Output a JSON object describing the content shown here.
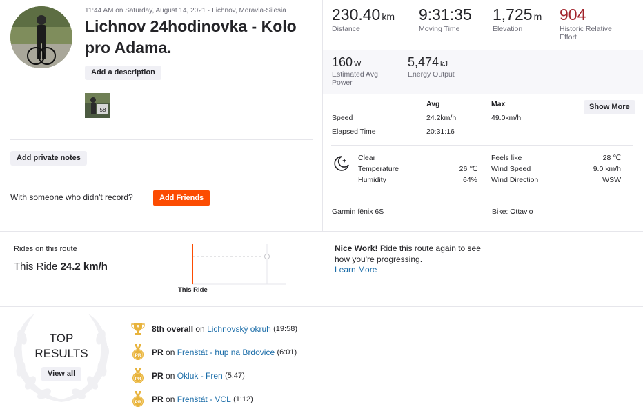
{
  "activity": {
    "timestamp": "11:44 AM on Saturday, August 14, 2021 · Lichnov, Moravia-Silesia",
    "title": "Lichnov 24hodinovka - Kolo pro Adama.",
    "add_description": "Add a description",
    "photo_badge": "58",
    "add_private_notes": "Add private notes",
    "friends_question": "With someone who didn't record?",
    "add_friends": "Add Friends"
  },
  "stats": {
    "distance": {
      "value": "230.40",
      "unit": "km",
      "label": "Distance"
    },
    "moving_time": {
      "value": "9:31:35",
      "unit": "",
      "label": "Moving Time"
    },
    "elevation": {
      "value": "1,725",
      "unit": "m",
      "label": "Elevation"
    },
    "relative_effort": {
      "value": "904",
      "unit": "",
      "label": "Historic Relative Effort"
    },
    "power": {
      "value": "160",
      "unit": "W",
      "label": "Estimated Avg Power"
    },
    "energy": {
      "value": "5,474",
      "unit": "kJ",
      "label": "Energy Output"
    }
  },
  "table": {
    "avg_header": "Avg",
    "max_header": "Max",
    "show_more": "Show More",
    "speed_label": "Speed",
    "speed_avg": "24.2km/h",
    "speed_max": "49.0km/h",
    "elapsed_label": "Elapsed Time",
    "elapsed_avg": "20:31:16"
  },
  "weather": {
    "condition": "Clear",
    "temperature_label": "Temperature",
    "temperature": "26 ℃",
    "humidity_label": "Humidity",
    "humidity": "64%",
    "feels_like_label": "Feels like",
    "feels_like": "28 ℃",
    "wind_speed_label": "Wind Speed",
    "wind_speed": "9.0 km/h",
    "wind_dir_label": "Wind Direction",
    "wind_dir": "WSW"
  },
  "device": {
    "name": "Garmin fēnix 6S",
    "bike": "Bike: Ottavio"
  },
  "route": {
    "label": "Rides on this route",
    "this_ride_prefix": "This Ride",
    "this_ride_speed": "24.2 km/h",
    "chart_caption": "This Ride",
    "nice_bold": "Nice Work!",
    "nice_text": "Ride this route again to see how you're progressing.",
    "learn_more": "Learn More"
  },
  "top_results": {
    "title_line1": "TOP",
    "title_line2": "RESULTS",
    "view_all": "View all",
    "items": [
      {
        "icon": "trophy-icon",
        "rank": "8th overall",
        "on": "on",
        "segment": "Lichnovský okruh",
        "time": "(19:58)",
        "badge": "8"
      },
      {
        "icon": "pr-medal-icon",
        "rank": "PR",
        "on": "on",
        "segment": "Frenštát - hup na Brdovice",
        "time": "(6:01)",
        "badge": "PR"
      },
      {
        "icon": "pr-medal-icon",
        "rank": "PR",
        "on": "on",
        "segment": "Okluk - Fren",
        "time": "(5:47)",
        "badge": "PR"
      },
      {
        "icon": "pr-medal-icon",
        "rank": "PR",
        "on": "on",
        "segment": "Frenštát - VCL",
        "time": "(1:12)",
        "badge": "PR"
      }
    ]
  },
  "colors": {
    "accent": "#fc4c02",
    "effort_red": "#a2242c",
    "link_blue": "#1a6ca8",
    "medal_gold": "#e8b33c"
  }
}
